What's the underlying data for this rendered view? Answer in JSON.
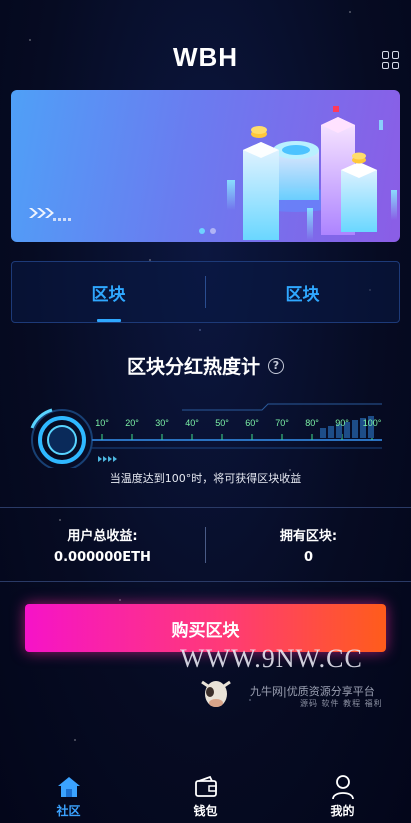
{
  "header": {
    "title": "WBH",
    "menu_icon": "grid-icon"
  },
  "banner": {
    "slides": 2,
    "active_slide": 0
  },
  "tabs": [
    {
      "label": "区块",
      "active": true
    },
    {
      "label": "区块",
      "active": false
    }
  ],
  "heat": {
    "title": "区块分红热度计",
    "help_icon": "question-icon",
    "ticks": [
      "10°",
      "20°",
      "30°",
      "40°",
      "50°",
      "60°",
      "70°",
      "80°",
      "90°",
      "100°"
    ],
    "note": "当温度达到100°时，将可获得区块收益"
  },
  "stats": [
    {
      "label": "用户总收益:",
      "value": "0.000000ETH"
    },
    {
      "label": "拥有区块:",
      "value": "0"
    }
  ],
  "buy_button": {
    "label": "购买区块"
  },
  "watermark": {
    "url": "WWW.9NW.CC",
    "name": "九牛网|优质资源分享平台",
    "sub": "源码 软件 教程 福利"
  },
  "nav": [
    {
      "label": "社区",
      "icon": "home-icon",
      "active": true
    },
    {
      "label": "钱包",
      "icon": "wallet-icon",
      "active": false
    },
    {
      "label": "我的",
      "icon": "user-icon",
      "active": false
    }
  ],
  "colors": {
    "accent": "#2fa8ff",
    "button_start": "#f613c8",
    "button_end": "#ff5c1b",
    "tick": "#7ef5a8"
  }
}
